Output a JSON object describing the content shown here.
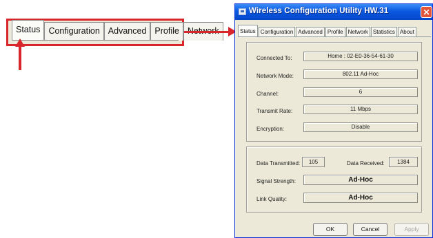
{
  "callout": {
    "tabs": [
      "Status",
      "Configuration",
      "Advanced",
      "Profile",
      "Network"
    ]
  },
  "window": {
    "title": "Wireless Configuration Utility HW.31",
    "close_glyph": "✕",
    "tabs": [
      "Status",
      "Configuration",
      "Advanced",
      "Profile",
      "Network",
      "Statistics",
      "About"
    ],
    "status": {
      "connected_to_label": "Connected To:",
      "connected_to_value": "Home : 02-E0-36-54-61-30",
      "network_mode_label": "Network Mode:",
      "network_mode_value": "802.11 Ad-Hoc",
      "channel_label": "Channel:",
      "channel_value": "6",
      "transmit_rate_label": "Transmit Rate:",
      "transmit_rate_value": "11 Mbps",
      "encryption_label": "Encryption:",
      "encryption_value": "Disable"
    },
    "stats": {
      "data_transmitted_label": "Data Transmitted:",
      "data_transmitted_value": "105",
      "data_received_label": "Data Received:",
      "data_received_value": "1384",
      "signal_strength_label": "Signal Strength:",
      "signal_strength_value": "Ad-Hoc",
      "link_quality_label": "Link Quality:",
      "link_quality_value": "Ad-Hoc"
    },
    "buttons": {
      "ok": "OK",
      "cancel": "Cancel",
      "apply": "Apply"
    }
  },
  "colors": {
    "callout_red": "#d8262b",
    "titlebar_blue": "#0a58e0",
    "window_bg": "#ece9d8"
  }
}
